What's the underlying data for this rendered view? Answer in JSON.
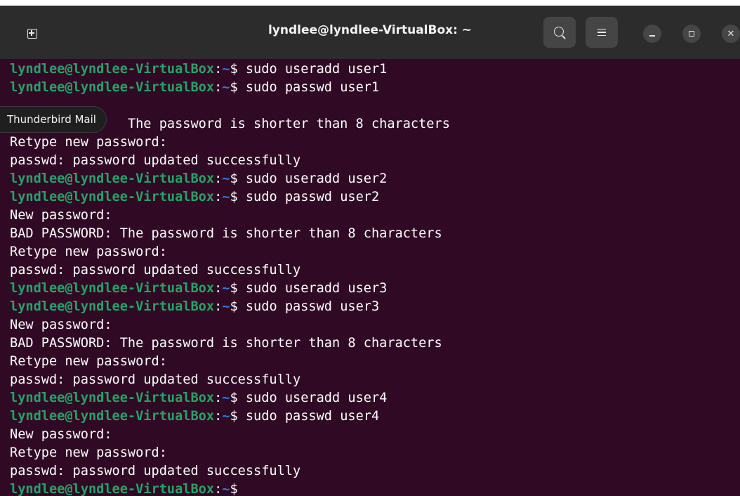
{
  "window": {
    "title": "lyndlee@lyndlee-VirtualBox: ~",
    "icons": {
      "new_tab": "new-tab-icon",
      "search": "search-icon",
      "menu": "hamburger-menu-icon",
      "minimize": "minimize-icon",
      "maximize": "maximize-icon",
      "close": "close-icon"
    },
    "close_glyph": "✕"
  },
  "tooltip": {
    "text": "Thunderbird Mail"
  },
  "colors": {
    "background": "#300a24",
    "prompt_user": "#26a269",
    "prompt_path": "#2a7bde",
    "text": "#ffffff",
    "titlebar": "#2c2c2c"
  },
  "terminal": {
    "prompt_user": "lyndlee@lyndlee-VirtualBox",
    "prompt_sep": ":",
    "prompt_path": "~",
    "prompt_dollar": "$",
    "lines": [
      {
        "type": "cmd",
        "text": " sudo useradd user1"
      },
      {
        "type": "cmd",
        "text": " sudo passwd user1"
      },
      {
        "type": "out",
        "text": ""
      },
      {
        "type": "out",
        "text": "               The password is shorter than 8 characters"
      },
      {
        "type": "out",
        "text": "Retype new password:"
      },
      {
        "type": "out",
        "text": "passwd: password updated successfully"
      },
      {
        "type": "cmd",
        "text": " sudo useradd user2"
      },
      {
        "type": "cmd",
        "text": " sudo passwd user2"
      },
      {
        "type": "out",
        "text": "New password:"
      },
      {
        "type": "out",
        "text": "BAD PASSWORD: The password is shorter than 8 characters"
      },
      {
        "type": "out",
        "text": "Retype new password:"
      },
      {
        "type": "out",
        "text": "passwd: password updated successfully"
      },
      {
        "type": "cmd",
        "text": " sudo useradd user3"
      },
      {
        "type": "cmd",
        "text": " sudo passwd user3"
      },
      {
        "type": "out",
        "text": "New password:"
      },
      {
        "type": "out",
        "text": "BAD PASSWORD: The password is shorter than 8 characters"
      },
      {
        "type": "out",
        "text": "Retype new password:"
      },
      {
        "type": "out",
        "text": "passwd: password updated successfully"
      },
      {
        "type": "cmd",
        "text": " sudo useradd user4"
      },
      {
        "type": "cmd",
        "text": " sudo passwd user4"
      },
      {
        "type": "out",
        "text": "New password:"
      },
      {
        "type": "out",
        "text": "Retype new password:"
      },
      {
        "type": "out",
        "text": "passwd: password updated successfully"
      },
      {
        "type": "cmd",
        "text": ""
      }
    ]
  }
}
